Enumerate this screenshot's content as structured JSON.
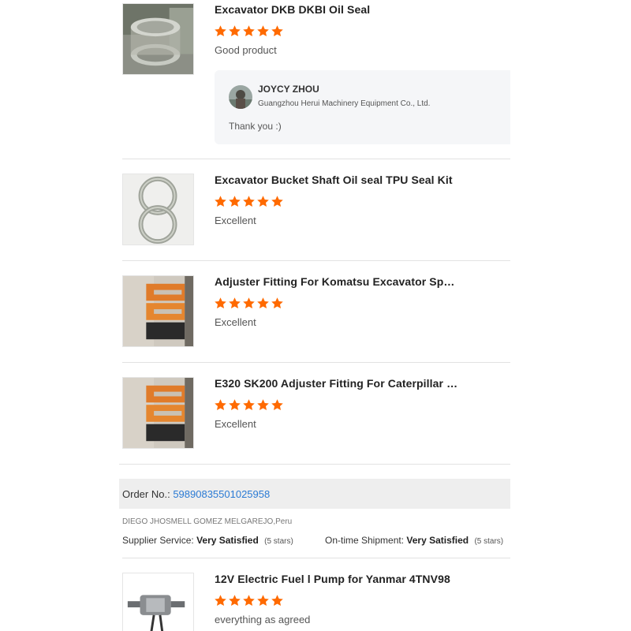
{
  "colors": {
    "star": "#ff6a00",
    "link": "#2a7ad4",
    "divider": "#e2e2e2",
    "panel": "#f5f6f8"
  },
  "reviews": [
    {
      "product_title": "Excavator DKB DKBI Oil Seal",
      "rating": 5,
      "comment": "Good product",
      "thumbnail": "oil-seal-photo",
      "reply": {
        "name": "JOYCY ZHOU",
        "company": "Guangzhou Herui Machinery Equipment Co., Ltd.",
        "text": "Thank you :)"
      }
    },
    {
      "product_title": "Excavator Bucket Shaft Oil seal TPU Seal Kit",
      "rating": 5,
      "comment": "Excellent",
      "thumbnail": "seal-rings-photo"
    },
    {
      "product_title": "Adjuster Fitting For Komatsu Excavator Spare ...",
      "rating": 5,
      "comment": "Excellent",
      "thumbnail": "adjuster-fitting-photo"
    },
    {
      "product_title": "E320 SK200 Adjuster Fitting For Caterpillar Ko...",
      "rating": 5,
      "comment": "Excellent",
      "thumbnail": "adjuster-fitting-photo"
    }
  ],
  "order": {
    "label": "Order No.:",
    "number": "59890835501025958",
    "buyer": "DIEGO JHOSMELL GOMEZ MELGAREJO,Peru",
    "supplier_service_label": "Supplier Service:",
    "supplier_service_value": "Very Satisfied",
    "supplier_service_stars": "(5 stars)",
    "shipment_label": "On-time Shipment:",
    "shipment_value": "Very Satisfied",
    "shipment_stars": "(5 stars)"
  },
  "last_review": {
    "product_title": "12V Electric Fuel l Pump for Yanmar 4TNV98",
    "rating": 5,
    "comment": "everything as agreed",
    "thumbnail": "fuel-pump-photo"
  }
}
